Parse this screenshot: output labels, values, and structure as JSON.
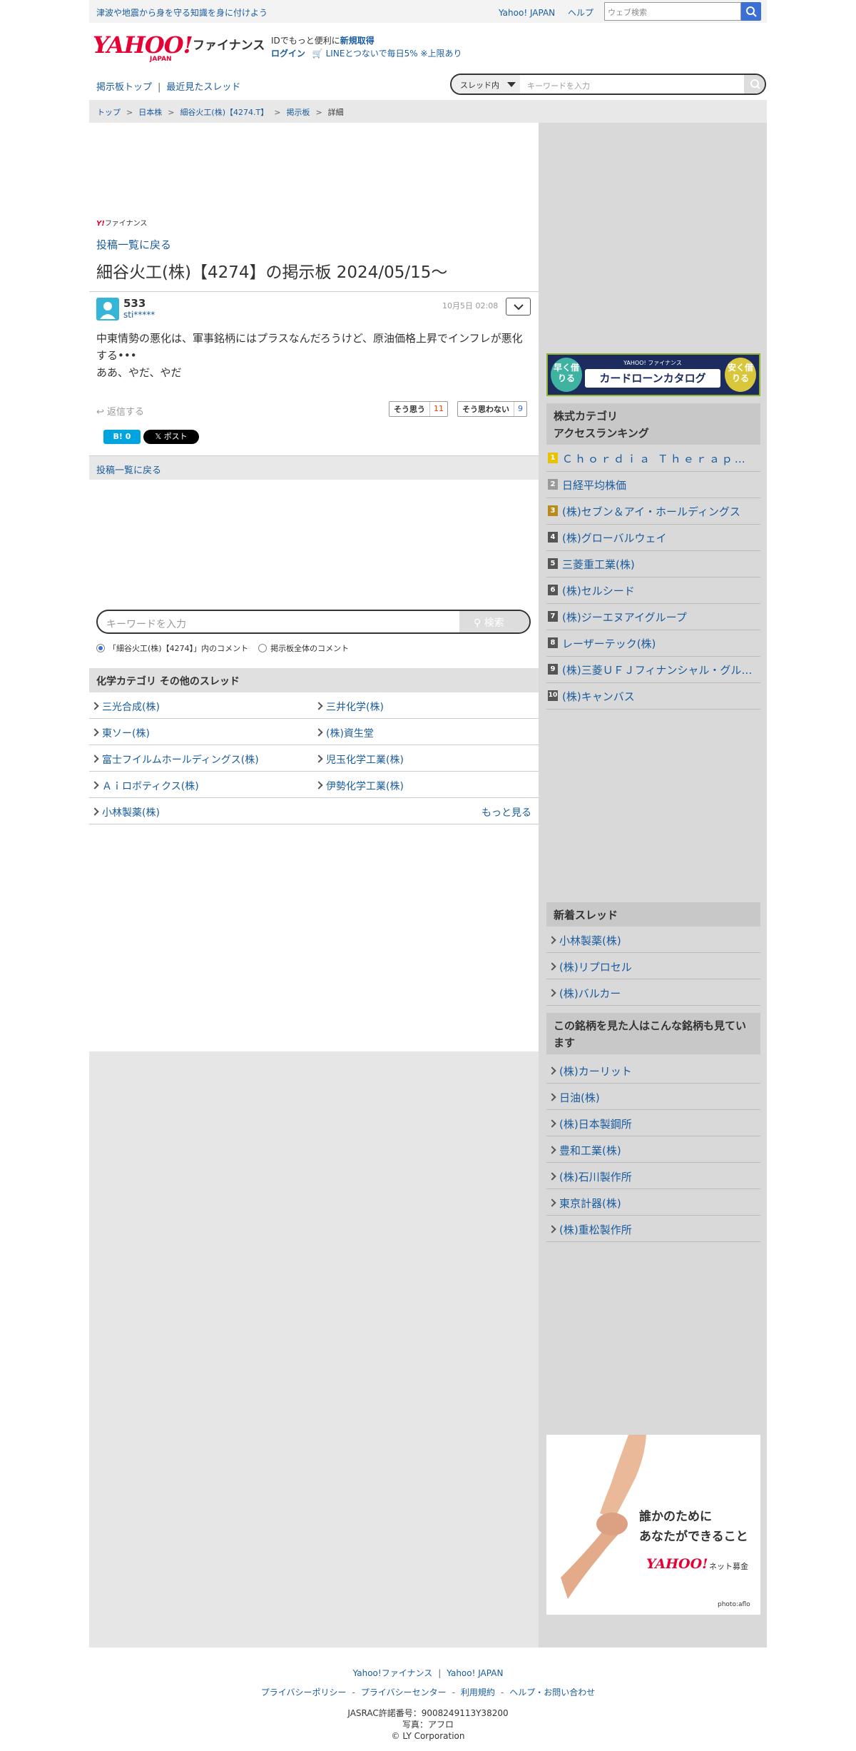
{
  "topbar": {
    "notice": "津波や地震から身を守る知識を身に付けよう",
    "links": [
      "Yahoo! JAPAN",
      "ヘルプ"
    ],
    "web_search_placeholder": "ウェブ検索"
  },
  "header": {
    "logo_text": "YAHOO!",
    "logo_sub": "JAPAN",
    "service": "ファイナンス",
    "id_prefix": "IDでもっと便利に",
    "id_link": "新規取得",
    "login": "ログイン",
    "line_promo": "LINEとつないで毎日5% ※上限あり"
  },
  "boardnav": {
    "top": "掲示板トップ",
    "recent": "最近見たスレッド",
    "scope": "スレッド内",
    "placeholder": "キーワードを入力"
  },
  "breadcrumb": [
    "トップ",
    "日本株",
    "細谷火工(株)【4274.T】",
    "掲示板",
    "詳細"
  ],
  "post": {
    "brand": "ファイナンス",
    "back_label": "投稿一覧に戻る",
    "title": "細谷火工(株)【4274】の掲示板 2024/05/15〜",
    "author": "533",
    "author_id": "sti*****",
    "date": "10月5日 02:08",
    "body_lines": [
      "中東情勢の悪化は、軍事銘柄にはプラスなんだろうけど、原油価格上昇でインフレが悪化する•••",
      "ああ、やだ、やだ"
    ],
    "reply": "返信する",
    "agree_label": "そう思う",
    "agree_count": "11",
    "disagree_label": "そう思わない",
    "disagree_count": "9",
    "hatena": "B! 0",
    "x_post": "ポスト"
  },
  "keyword_search": {
    "placeholder": "キーワードを入力",
    "button": "検索",
    "scope_option1": "「細谷火工(株)【4274】」内のコメント",
    "scope_option2": "掲示板全体のコメント"
  },
  "category": {
    "heading": "化学カテゴリ その他のスレッド",
    "rows": [
      [
        "三光合成(株)",
        "三井化学(株)"
      ],
      [
        "東ソー(株)",
        "(株)資生堂"
      ],
      [
        "富士フイルムホールディングス(株)",
        "児玉化学工業(株)"
      ],
      [
        "Ａｉロボティクス(株)",
        "伊勢化学工業(株)"
      ]
    ],
    "last": "小林製薬(株)",
    "more": "もっと見る"
  },
  "sidebar": {
    "ad": {
      "small": "YAHOO! ファイナンス",
      "main": "カードローンカタログ",
      "left": "早く借りる",
      "right": "安く借りる"
    },
    "ranking_heading_1": "株式カテゴリ",
    "ranking_heading_2": "アクセスランキング",
    "ranking": [
      "Ｃｈｏｒｄｉａ Ｔｈｅｒａｐｅｕｔｉｃｓ(株)",
      "日経平均株価",
      "(株)セブン＆アイ・ホールディングス",
      "(株)グローバルウェイ",
      "三菱重工業(株)",
      "(株)セルシード",
      "(株)ジーエヌアイグループ",
      "レーザーテック(株)",
      "(株)三菱ＵＦＪフィナンシャル・グループ",
      "(株)キャンバス"
    ],
    "new_heading": "新着スレッド",
    "new_threads": [
      "小林製薬(株)",
      "(株)リプロセル",
      "(株)バルカー"
    ],
    "viewed_heading": "この銘柄を見た人はこんな銘柄も見ています",
    "viewed": [
      "(株)カーリット",
      "日油(株)",
      "(株)日本製鋼所",
      "豊和工業(株)",
      "(株)石川製作所",
      "東京計器(株)",
      "(株)重松製作所"
    ],
    "charity": {
      "line1": "誰かのために",
      "line2": "あなたができること",
      "logo": "YAHOO!",
      "logo_sub": "ネット募金",
      "credit": "photo:aflo"
    }
  },
  "footer": {
    "links1": [
      "Yahoo!ファイナンス",
      "Yahoo! JAPAN"
    ],
    "links2": [
      "プライバシーポリシー",
      "プライバシーセンター",
      "利用規約",
      "ヘルプ・お問い合わせ"
    ],
    "jasrac": "JASRAC許諾番号：9008249113Y38200",
    "photo": "写真：アフロ",
    "copyright": "© LY Corporation"
  },
  "colors": {
    "brand_red": "#e60033",
    "link": "#1a5c9e",
    "agree": "#e63b00",
    "disagree": "#3366cc"
  }
}
